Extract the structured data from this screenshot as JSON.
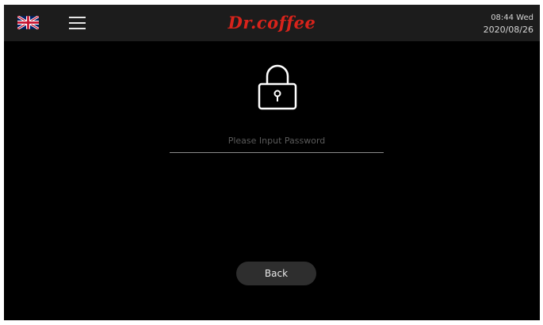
{
  "header": {
    "language_flag": "uk-flag-icon",
    "menu_icon": "hamburger-menu-icon",
    "brand": "Dr.coffee",
    "time": "08:44 Wed",
    "date": "2020/08/26"
  },
  "login": {
    "lock_icon": "padlock-icon",
    "password_placeholder": "Please Input Password",
    "password_value": "",
    "back_label": "Back"
  },
  "colors": {
    "background": "#000000",
    "header_bar": "#1c1c1c",
    "brand_red": "#d8231b",
    "button_bg": "#2e2e2e"
  }
}
